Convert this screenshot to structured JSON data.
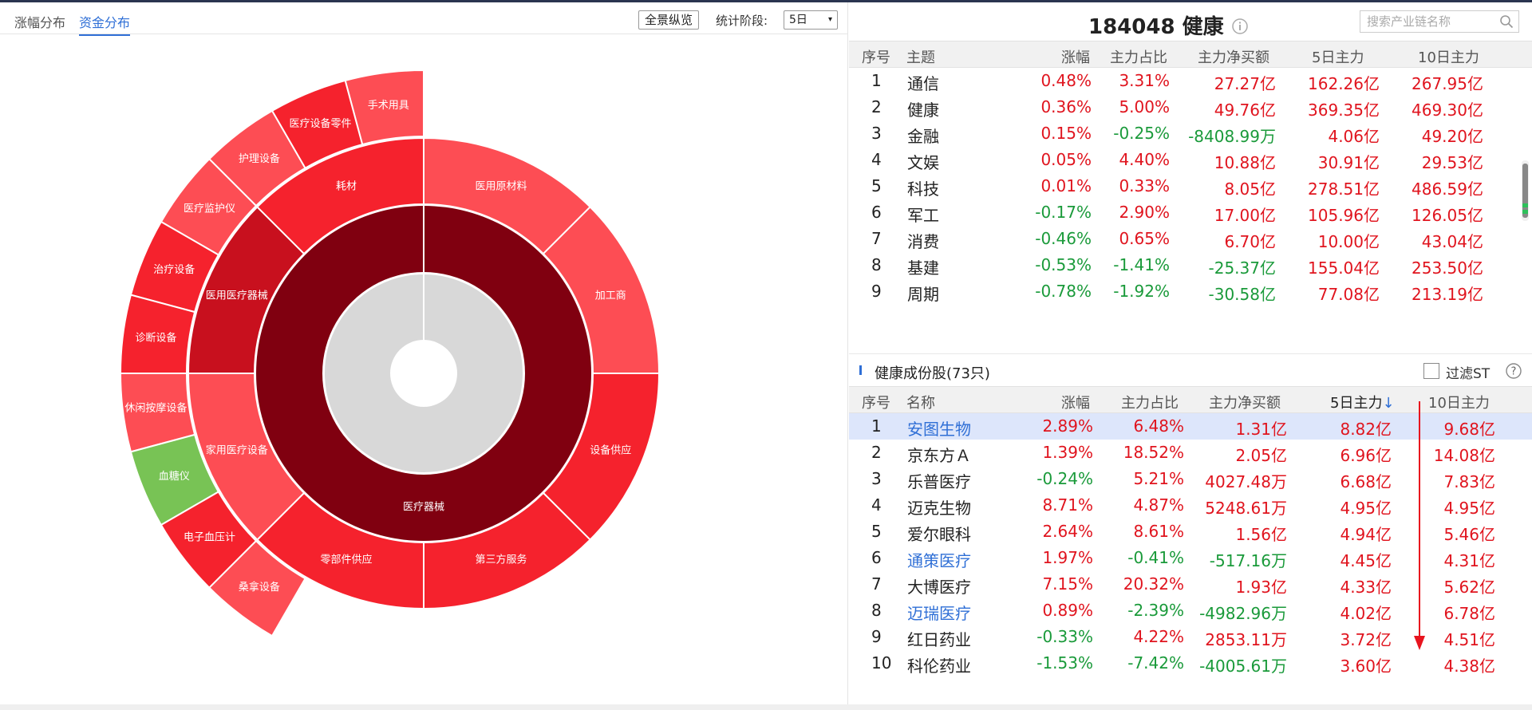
{
  "left": {
    "tabs": [
      {
        "label": "涨幅分布",
        "active": false
      },
      {
        "label": "资金分布",
        "active": true
      }
    ],
    "overview_button": "全景纵览",
    "period_label": "统计阶段:",
    "period_value": "5日",
    "caret": "▾"
  },
  "colors": {
    "red_strong": "#f5222d",
    "red_light": "#fd4d54",
    "red_mid": "#c8101e",
    "red_dark": "#800010",
    "green": "#78c355",
    "center": "#d8d8d8"
  },
  "sunburst": {
    "center": "医疗器械",
    "ring1": [
      {
        "label": "医用原材料",
        "color": "red_light"
      },
      {
        "label": "加工商",
        "color": "red_light"
      },
      {
        "label": "设备供应",
        "color": "red_strong"
      },
      {
        "label": "第三方服务",
        "color": "red_strong"
      },
      {
        "label": "零部件供应",
        "color": "red_strong"
      },
      {
        "label": "家用医疗设备",
        "color": "red_light"
      },
      {
        "label": "医用医疗器械",
        "color": "red_mid"
      },
      {
        "label": "耗材",
        "color": "red_strong"
      }
    ],
    "ring2": [
      {
        "label": "手术用具",
        "color": "red_light"
      },
      {
        "label": "医疗设备零件",
        "color": "red_strong"
      },
      {
        "label": "护理设备",
        "color": "red_light"
      },
      {
        "label": "医疗监护仪",
        "color": "red_light"
      },
      {
        "label": "治疗设备",
        "color": "red_strong"
      },
      {
        "label": "诊断设备",
        "color": "red_strong"
      },
      {
        "label": "休闲按摩设备",
        "color": "red_light"
      },
      {
        "label": "血糖仪",
        "color": "green"
      },
      {
        "label": "电子血压计",
        "color": "red_strong"
      },
      {
        "label": "桑拿设备",
        "color": "red_light"
      }
    ]
  },
  "header": {
    "code": "184048",
    "name": "健康",
    "search_placeholder": "搜索产业链名称"
  },
  "themes": {
    "columns": [
      "序号",
      "主题",
      "涨幅",
      "主力占比",
      "主力净买额",
      "5日主力",
      "10日主力"
    ],
    "rows": [
      {
        "no": "1",
        "name": "通信",
        "chg": "0.48%",
        "ratio": "3.31%",
        "net": "27.27亿",
        "d5": "162.26亿",
        "d10": "267.95亿"
      },
      {
        "no": "2",
        "name": "健康",
        "chg": "0.36%",
        "ratio": "5.00%",
        "net": "49.76亿",
        "d5": "369.35亿",
        "d10": "469.30亿"
      },
      {
        "no": "3",
        "name": "金融",
        "chg": "0.15%",
        "ratio": "-0.25%",
        "net": "-8408.99万",
        "d5": "4.06亿",
        "d10": "49.20亿"
      },
      {
        "no": "4",
        "name": "文娱",
        "chg": "0.05%",
        "ratio": "4.40%",
        "net": "10.88亿",
        "d5": "30.91亿",
        "d10": "29.53亿"
      },
      {
        "no": "5",
        "name": "科技",
        "chg": "0.01%",
        "ratio": "0.33%",
        "net": "8.05亿",
        "d5": "278.51亿",
        "d10": "486.59亿"
      },
      {
        "no": "6",
        "name": "军工",
        "chg": "-0.17%",
        "ratio": "2.90%",
        "net": "17.00亿",
        "d5": "105.96亿",
        "d10": "126.05亿"
      },
      {
        "no": "7",
        "name": "消费",
        "chg": "-0.46%",
        "ratio": "0.65%",
        "net": "6.70亿",
        "d5": "10.00亿",
        "d10": "43.04亿"
      },
      {
        "no": "8",
        "name": "基建",
        "chg": "-0.53%",
        "ratio": "-1.41%",
        "net": "-25.37亿",
        "d5": "155.04亿",
        "d10": "253.50亿"
      },
      {
        "no": "9",
        "name": "周期",
        "chg": "-0.78%",
        "ratio": "-1.92%",
        "net": "-30.58亿",
        "d5": "77.08亿",
        "d10": "213.19亿"
      }
    ]
  },
  "constituents": {
    "title": "健康成份股(73只)",
    "filter_label": "过滤ST",
    "help": "?",
    "sort_arrow": "↓",
    "columns": [
      "序号",
      "名称",
      "涨幅",
      "主力占比",
      "主力净买额",
      "5日主力",
      "10日主力"
    ],
    "rows": [
      {
        "no": "1",
        "name": "安图生物",
        "chg": "2.89%",
        "ratio": "6.48%",
        "net": "1.31亿",
        "d5": "8.82亿",
        "d10": "9.68亿",
        "link": true,
        "selected": true
      },
      {
        "no": "2",
        "name": "京东方Ａ",
        "chg": "1.39%",
        "ratio": "18.52%",
        "net": "2.05亿",
        "d5": "6.96亿",
        "d10": "14.08亿",
        "link": false
      },
      {
        "no": "3",
        "name": "乐普医疗",
        "chg": "-0.24%",
        "ratio": "5.21%",
        "net": "4027.48万",
        "d5": "6.68亿",
        "d10": "7.83亿",
        "link": false
      },
      {
        "no": "4",
        "name": "迈克生物",
        "chg": "8.71%",
        "ratio": "4.87%",
        "net": "5248.61万",
        "d5": "4.95亿",
        "d10": "4.95亿",
        "link": false
      },
      {
        "no": "5",
        "name": "爱尔眼科",
        "chg": "2.64%",
        "ratio": "8.61%",
        "net": "1.56亿",
        "d5": "4.94亿",
        "d10": "5.46亿",
        "link": false
      },
      {
        "no": "6",
        "name": "通策医疗",
        "chg": "1.97%",
        "ratio": "-0.41%",
        "net": "-517.16万",
        "d5": "4.45亿",
        "d10": "4.31亿",
        "link": true
      },
      {
        "no": "7",
        "name": "大博医疗",
        "chg": "7.15%",
        "ratio": "20.32%",
        "net": "1.93亿",
        "d5": "4.33亿",
        "d10": "5.62亿",
        "link": false
      },
      {
        "no": "8",
        "name": "迈瑞医疗",
        "chg": "0.89%",
        "ratio": "-2.39%",
        "net": "-4982.96万",
        "d5": "4.02亿",
        "d10": "6.78亿",
        "link": true
      },
      {
        "no": "9",
        "name": "红日药业",
        "chg": "-0.33%",
        "ratio": "4.22%",
        "net": "2853.11万",
        "d5": "3.72亿",
        "d10": "4.51亿",
        "link": false
      },
      {
        "no": "10",
        "name": "科伦药业",
        "chg": "-1.53%",
        "ratio": "-7.42%",
        "net": "-4005.61万",
        "d5": "3.60亿",
        "d10": "4.38亿",
        "link": false
      }
    ]
  }
}
